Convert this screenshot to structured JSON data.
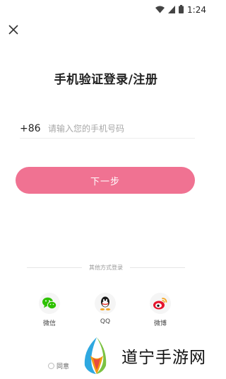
{
  "status_bar": {
    "time": "1:24"
  },
  "page": {
    "title": "手机验证登录/注册"
  },
  "phone": {
    "country_code": "+86",
    "placeholder": "请输入您的手机号码"
  },
  "next_button": {
    "label": "下一步"
  },
  "divider": {
    "text": "其他方式登录"
  },
  "social": [
    {
      "label": "微信",
      "icon": "wechat-icon"
    },
    {
      "label": "QQ",
      "icon": "qq-icon"
    },
    {
      "label": "微博",
      "icon": "weibo-icon"
    }
  ],
  "agreement": {
    "text": "同意"
  },
  "watermark": {
    "text": "道宁手游网"
  },
  "colors": {
    "accent": "#f07292",
    "wechat": "#2dc100",
    "weibo": "#e6162d"
  }
}
